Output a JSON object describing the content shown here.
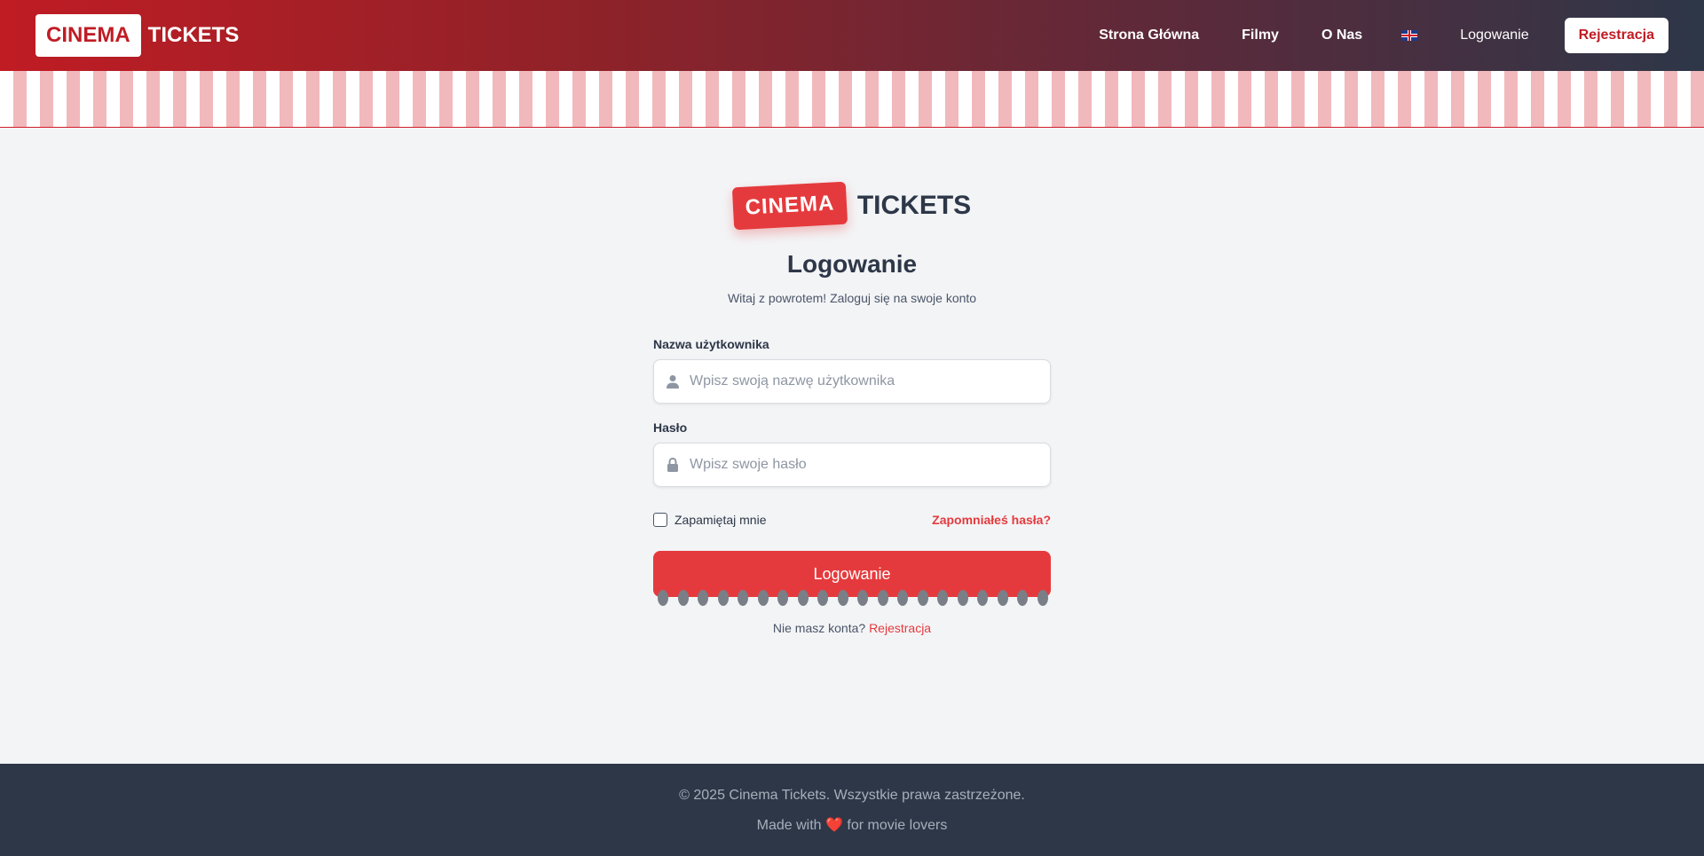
{
  "header": {
    "brand_box": "CINEMA",
    "brand_text": "TICKETS",
    "nav": {
      "home": "Strona Główna",
      "films": "Filmy",
      "about": "O Nas",
      "language_icon": "uk-flag-icon",
      "login": "Logowanie",
      "register": "Rejestracja"
    }
  },
  "logo": {
    "tag": "CINEMA",
    "word": "TICKETS"
  },
  "page": {
    "title": "Logowanie",
    "subtitle": "Witaj z powrotem! Zaloguj się na swoje konto"
  },
  "form": {
    "username": {
      "label": "Nazwa użytkownika",
      "placeholder": "Wpisz swoją nazwę użytkownika",
      "value": "",
      "icon": "user-icon"
    },
    "password": {
      "label": "Hasło",
      "placeholder": "Wpisz swoje hasło",
      "value": "",
      "icon": "lock-icon"
    },
    "remember_label": "Zapamiętaj mnie",
    "remember_checked": false,
    "forgot_link": "Zapomniałeś hasła?",
    "submit_label": "Logowanie"
  },
  "signup": {
    "prompt": "Nie masz konta?",
    "link": "Rejestracja"
  },
  "footer": {
    "copyright": "© 2025 Cinema Tickets. Wszystkie prawa zastrzeżone.",
    "made_with_prefix": "Made with",
    "heart": "❤️",
    "made_with_suffix": "for movie lovers"
  },
  "colors": {
    "accent": "#e53a3d",
    "brand_red": "#c01c24",
    "dark": "#2d3748",
    "footer_bg": "#2e3748",
    "stripe_pink": "#f1b9bc"
  }
}
